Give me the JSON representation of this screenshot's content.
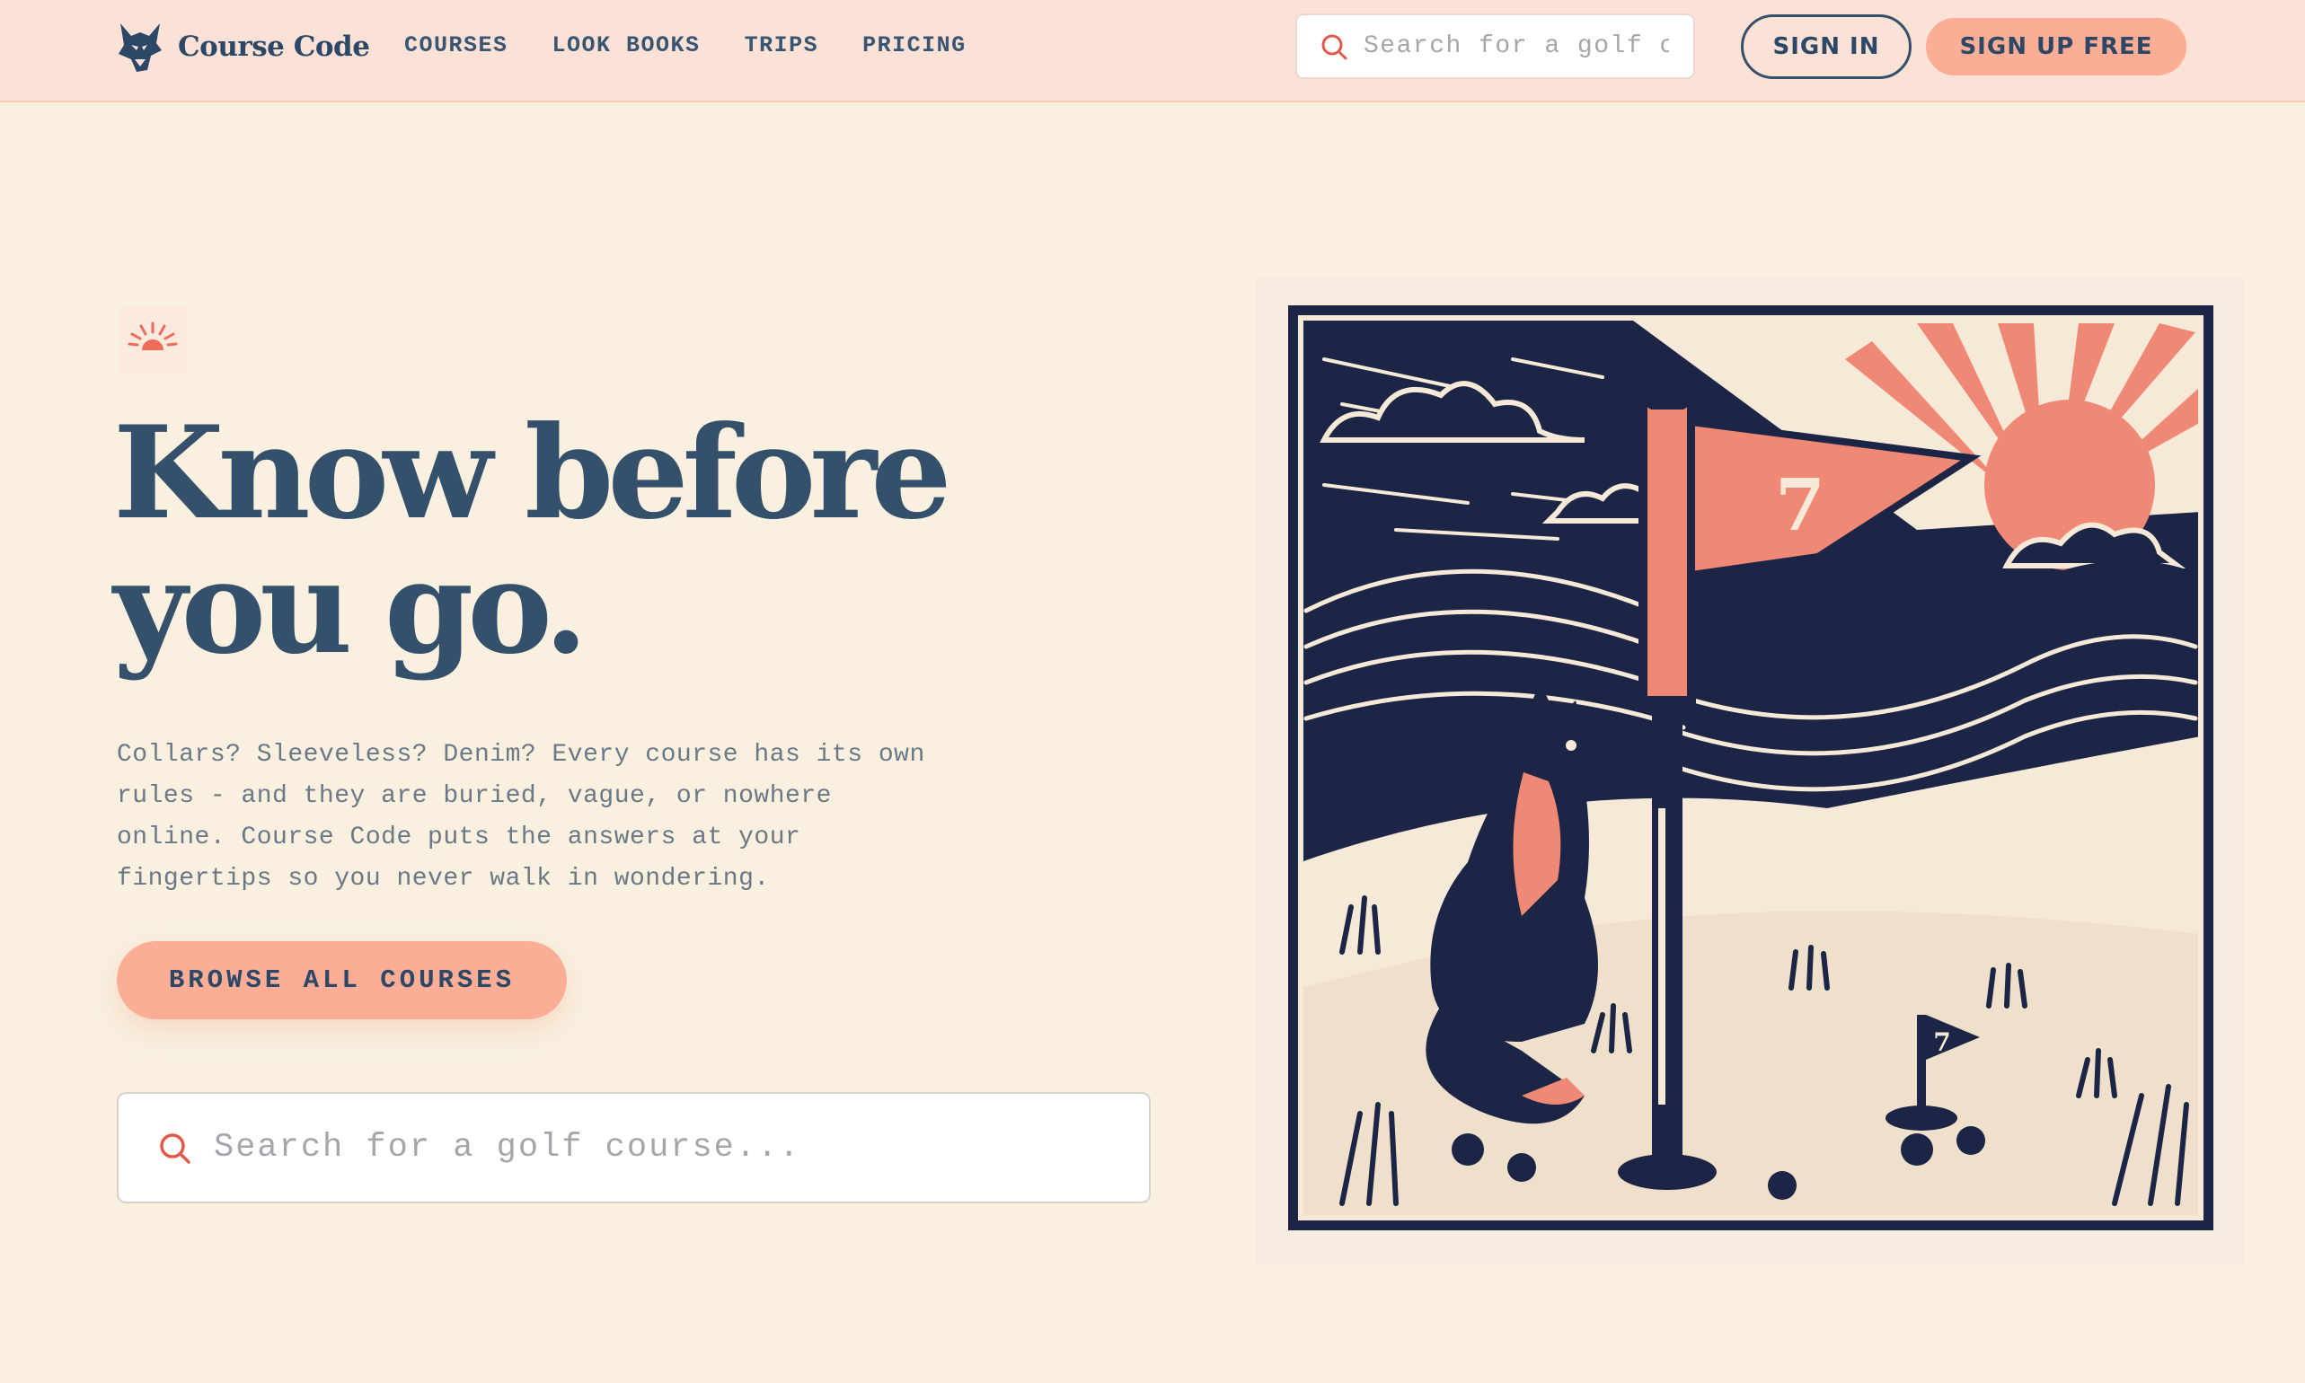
{
  "header": {
    "brand": {
      "name": "Course Code",
      "logo_icon": "fox-icon"
    },
    "nav": [
      {
        "label": "COURSES"
      },
      {
        "label": "LOOK BOOKS"
      },
      {
        "label": "TRIPS"
      },
      {
        "label": "PRICING"
      }
    ],
    "search": {
      "placeholder": "Search for a golf course...",
      "icon": "search-icon"
    },
    "sign_in_label": "SIGN IN",
    "sign_up_label": "SIGN UP FREE"
  },
  "hero": {
    "badge_icon": "sunrise-icon",
    "title_line1": "Know before",
    "title_line2": "you go.",
    "description": "Collars? Sleeveless? Denim? Every course has its own rules - and they are buried, vague, or nowhere online. Course Code puts the answers at your fingertips so you never walk in wondering.",
    "browse_label": "BROWSE ALL COURSES",
    "search": {
      "placeholder": "Search for a golf course...",
      "icon": "search-icon"
    }
  },
  "illustration": {
    "flag_number": "7",
    "hole_flag_number": "7",
    "subject": "fox-golf-flag-linocut"
  },
  "colors": {
    "background": "#f9f0e0",
    "header": "#fbe1d6",
    "navy": "#34506b",
    "coral": "#fbae95",
    "illustration_navy": "#1c2545",
    "illustration_coral": "#f08876"
  }
}
